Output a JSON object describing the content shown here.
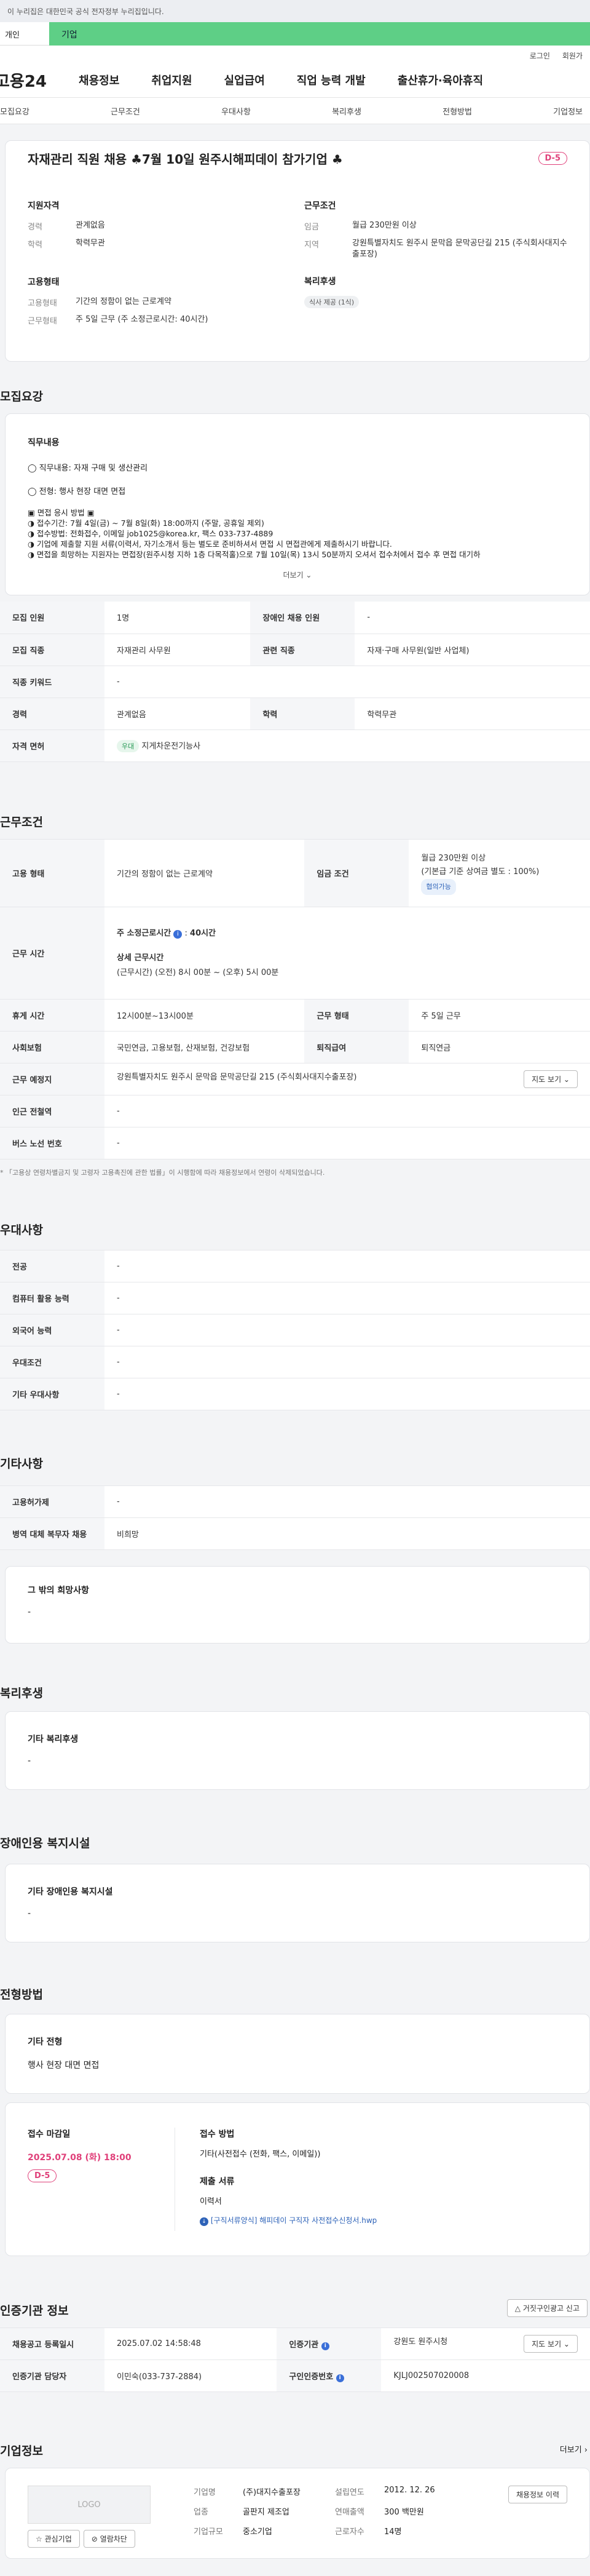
{
  "topnote": "이 누리집은 대한민국 공식 전자정부 누리집입니다.",
  "env": {
    "personal": "개인",
    "company": "기업"
  },
  "util": {
    "login": "로그인",
    "join": "회원가"
  },
  "gnb": {
    "logo": "고용24",
    "items": [
      "채용정보",
      "취업지원",
      "실업급여",
      "직업 능력 개발",
      "출산휴가·육아휴직"
    ]
  },
  "snb": [
    "모집요강",
    "근무조건",
    "우대사항",
    "복리후생",
    "전형방법",
    "기업정보"
  ],
  "job": {
    "title": "자재관리 직원 채용 ♣7월 10일 원주시해피데이 참가기업 ♣",
    "dday": "D-5",
    "qual_title": "지원자격",
    "qual": [
      {
        "k": "경력",
        "v": "관계없음"
      },
      {
        "k": "학력",
        "v": "학력무관"
      }
    ],
    "cond_title": "근무조건",
    "cond": [
      {
        "k": "임금",
        "v": "월급 230만원 이상"
      },
      {
        "k": "지역",
        "v": "강원특별자치도 원주시 문막읍 문막공단길 215 (주식회사대지수출포장)"
      }
    ],
    "emp_title": "고용형태",
    "emp": [
      {
        "k": "고용형태",
        "v": "기간의 정함이 없는 근로계약"
      },
      {
        "k": "근무형태",
        "v": "주 5일 근무 (주 소정근로시간: 40시간)"
      }
    ],
    "welfare_title": "복리후생",
    "welfare_chip": "식사 제공 (1식)"
  },
  "recruit": {
    "title": "모집요강",
    "duty_title": "직무내용",
    "duties": [
      "◯ 직무내용: 자재 구매 및 생산관리",
      "◯ 전형: 행사 현장 대면 면접"
    ],
    "method_head": "▣ 면접 응시 방법 ▣",
    "methods": [
      "◑ 접수기간: 7월 4일(금) ~ 7월 8일(화) 18:00까지 (주말, 공휴일 제외)",
      "◑ 접수방법:  전화접수, 이메일 job1025@korea.kr, 팩스 033-737-4889",
      "◑ 기업에 제출할 지원 서류(이력서, 자기소개서 등는 별도로 준비하셔서 면접 시 면접관에게 제출하시기 바랍니다.",
      "◑ 면접을 희망하는 지원자는 면접장(원주시청 지하 1층 다목적홀)으로 7월 10일(목) 13시 50분까지 오셔서 접수처에서 접수 후 면접 대기하"
    ],
    "more": "더보기 ⌄",
    "rows": [
      [
        "모집 인원",
        "1명",
        "장애인 채용 인원",
        "-"
      ],
      [
        "모집 직종",
        "자재관리 사무원",
        "관련 직종",
        "자재·구매 사무원(일반 사업체)"
      ],
      [
        "직종 키워드",
        "-",
        "",
        ""
      ],
      [
        "경력",
        "관계없음",
        "학력",
        "학력무관"
      ]
    ],
    "license_k": "자격 면허",
    "license_chip": "우대",
    "license_v": "지게차운전기능사"
  },
  "work": {
    "title": "근무조건",
    "r1": [
      "고용 형태",
      "기간의 정함이 없는 근로계약",
      "임금 조건",
      "월급 230만원 이상",
      "(기본급 기준 상여금 별도 : 100%)",
      "협의가능"
    ],
    "r2_k": "근무 시간",
    "r2_a": "주 소정근로시간",
    "r2_b": "40시간",
    "r2_c": "상세 근무시간",
    "r2_d": "(근무시간) (오전) 8시 00분 ~ (오후) 5시 00분",
    "r3": [
      "휴게 시간",
      "12시00분~13시00분",
      "근무 형태",
      "주 5일 근무"
    ],
    "r4": [
      "사회보험",
      "국민연금, 고용보험, 산재보험, 건강보험",
      "퇴직급여",
      "퇴직연금"
    ],
    "r5": [
      "근무 예정지",
      "강원특별자치도 원주시 문막읍 문막공단길 215 (주식회사대지수출포장)",
      "지도 보기 ⌄"
    ],
    "r6": [
      "인근 전철역",
      "-"
    ],
    "r7": [
      "버스 노선 번호",
      "-"
    ],
    "note": "* 「고용상 연령차별금지 및 고령자 고용촉진에 관한 법률」이 시행함에 따라 채용정보에서 연령이 삭제되었습니다."
  },
  "pref": {
    "title": "우대사항",
    "rows": [
      [
        "전공",
        "-"
      ],
      [
        "컴퓨터 활용 능력",
        "-"
      ],
      [
        "외국어 능력",
        "-"
      ],
      [
        "우대조건",
        "-"
      ],
      [
        "기타 우대사항",
        "-"
      ]
    ]
  },
  "etc": {
    "title": "기타사항",
    "rows": [
      [
        "고용허가제",
        "-"
      ],
      [
        "병역 대체 복무자 채용",
        "비희망"
      ]
    ],
    "other_t": "그 밖의 희망사항",
    "other_v": "-"
  },
  "welfare": {
    "title": "복리후생",
    "t": "기타 복리후생",
    "v": "-"
  },
  "disab": {
    "title": "장애인용 복지시설",
    "t": "기타 장애인용 복지시설",
    "v": "-"
  },
  "select": {
    "title": "전형방법",
    "t": "기타 전형",
    "v": "행사 현장 대면 면접",
    "deadline_t": "접수 마감일",
    "deadline": "2025.07.08 (화) 18:00",
    "dday": "D-5",
    "method_t": "접수 방법",
    "method": "기타(사전접수 (전화, 팩스, 이메일))",
    "docs_t": "제출 서류",
    "docs": "이력서",
    "file": "[구직서류양식] 해피데이 구직자 사전접수신청서.hwp"
  },
  "cert": {
    "title": "인증기관 정보",
    "report": "거짓구인광고 신고",
    "rows": [
      [
        "채용공고 등록일시",
        "2025.07.02 14:58:48",
        "인증기관",
        "강원도 원주시청",
        "지도 보기 ⌄"
      ],
      [
        "인증기관 담당자",
        "이민숙(033-737-2884)",
        "구인인증번호",
        "KJLJ002507020008",
        ""
      ]
    ]
  },
  "company": {
    "title": "기업정보",
    "more": "더보기 ›",
    "logo": "LOGO",
    "fav": "관심기업",
    "block": "열람차단",
    "rows": [
      [
        "기업명",
        "(주)대지수출포장",
        "설립연도",
        "2012. 12. 26"
      ],
      [
        "업종",
        "골판지 제조업",
        "연매출액",
        "300 백만원"
      ],
      [
        "기업규모",
        "중소기업",
        "근로자수",
        "14명"
      ]
    ],
    "move": "채용정보 이력"
  }
}
